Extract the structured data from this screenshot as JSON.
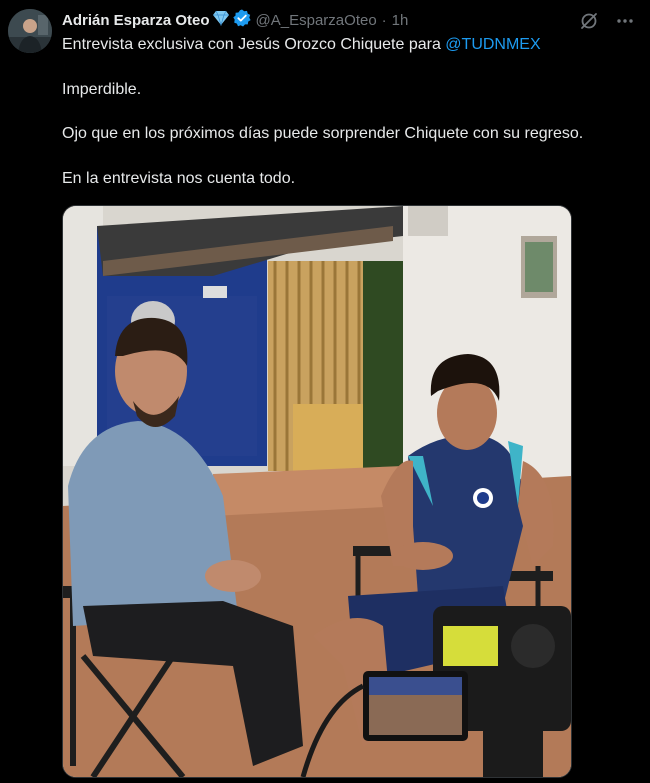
{
  "author": {
    "display_name": "Adrián Esparza Oteo",
    "handle": "@A_EsparzaOteo",
    "time": "1h",
    "separator": "·",
    "badge_icon": "diamond-icon",
    "verified_icon": "verified-badge-icon"
  },
  "tweet": {
    "line1_prefix": "Entrevista exclusiva con Jesús Orozco Chiquete para ",
    "mention": "@TUDNMEX",
    "line2": "Imperdible.",
    "line3": "Ojo que en los próximos días puede sorprender Chiquete con su regreso.",
    "line4": "En la entrevista nos cuenta todo."
  },
  "actions": {
    "grok_icon": "grok-icon",
    "more_icon": "more-options-icon"
  },
  "colors": {
    "background": "#000000",
    "text": "#e7e9ea",
    "secondary": "#71767b",
    "link": "#1d9bf0",
    "verified": "#1d9bf0"
  }
}
